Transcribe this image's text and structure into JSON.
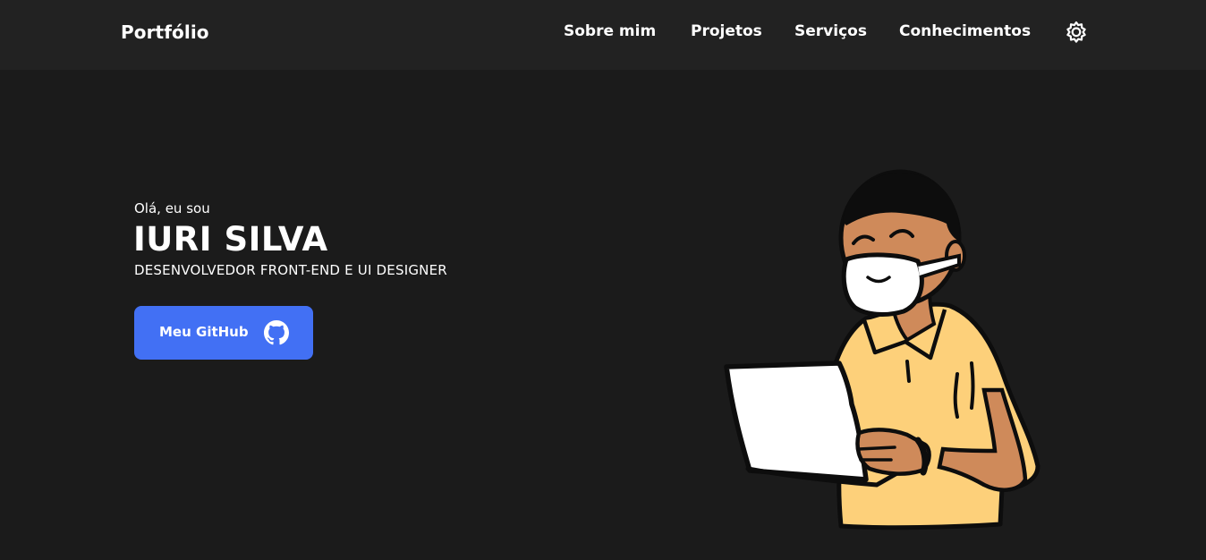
{
  "header": {
    "brand": "Portfólio",
    "nav": [
      "Sobre mim",
      "Projetos",
      "Serviços",
      "Conhecimentos"
    ],
    "theme_icon": "sun-gear-icon"
  },
  "hero": {
    "greeting": "Olá, eu sou",
    "name": "IURI SILVA",
    "role": "DESENVOLVEDOR FRONT-END E UI DESIGNER",
    "cta_label": "Meu GitHub",
    "cta_icon": "github-icon"
  },
  "colors": {
    "background": "#1b1b1b",
    "header": "#222222",
    "accent": "#4270f4",
    "shirt": "#fdd07a",
    "skin": "#cf8a5a"
  }
}
